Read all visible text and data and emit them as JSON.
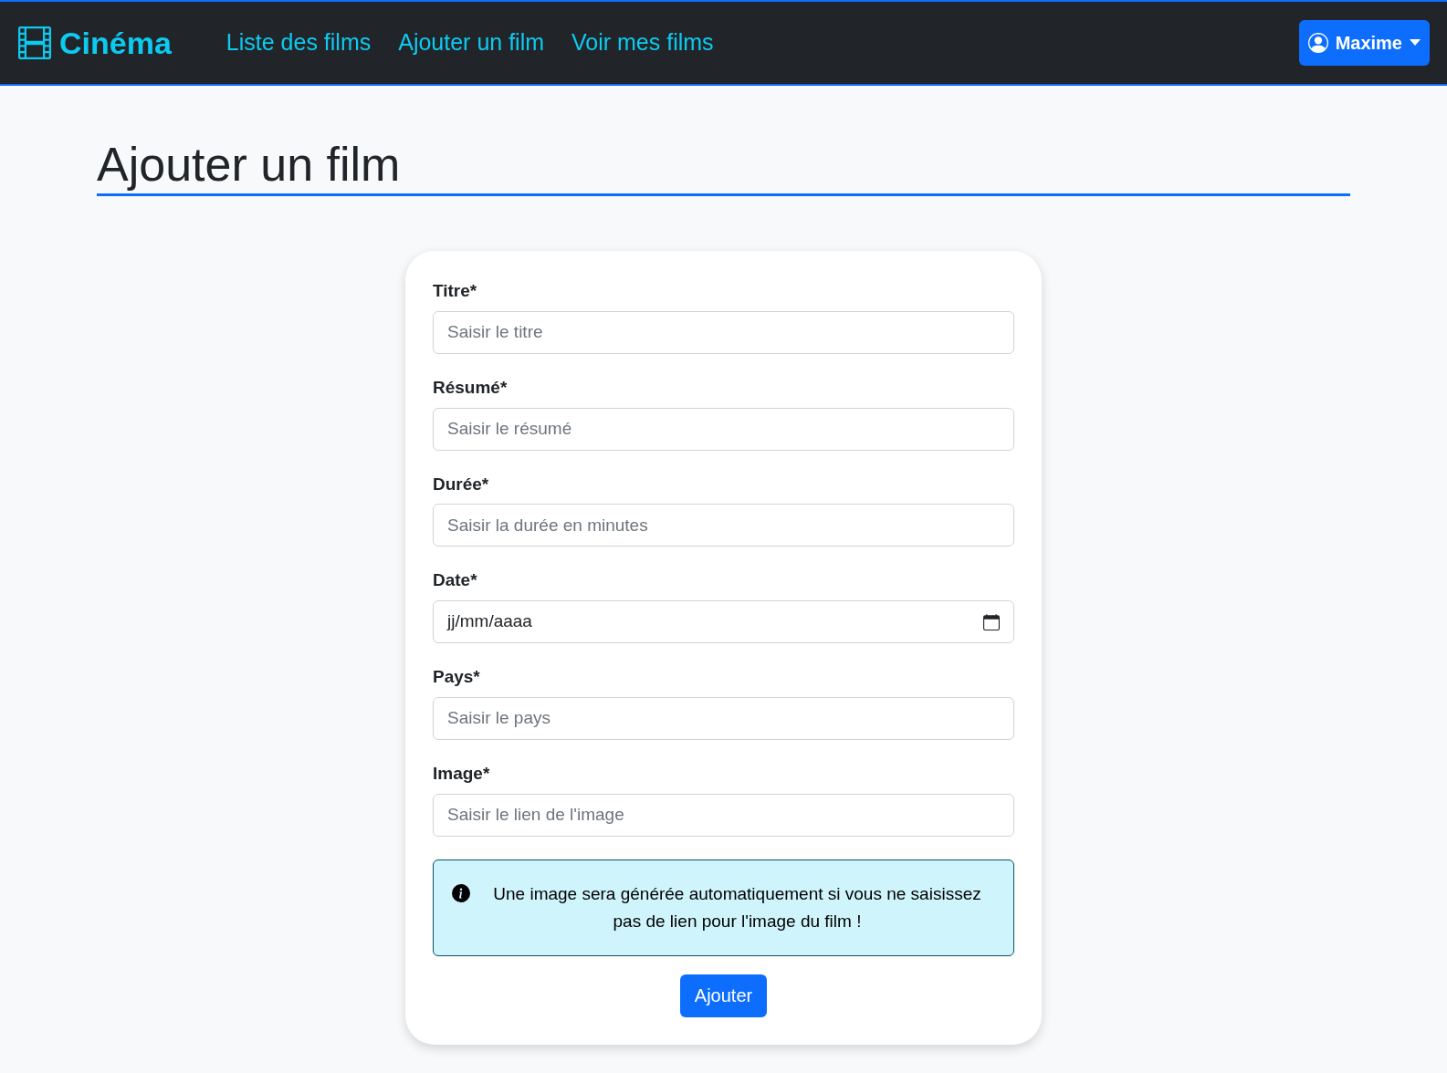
{
  "navbar": {
    "brand": "Cinéma",
    "links": [
      {
        "label": "Liste des films",
        "selected": false
      },
      {
        "label": "Ajouter un film",
        "selected": false
      },
      {
        "label": "Voir mes films",
        "selected": false
      }
    ],
    "user_menu": {
      "label": "Maxime"
    }
  },
  "page_title": "Ajouter un film",
  "form": {
    "fields": [
      {
        "kind": "text",
        "label": "Titre*",
        "placeholder": "Saisir le titre"
      },
      {
        "kind": "text",
        "label": "Résumé*",
        "placeholder": "Saisir le résumé"
      },
      {
        "kind": "text",
        "label": "Durée*",
        "placeholder": "Saisir la durée en minutes"
      },
      {
        "kind": "date",
        "label": "Date*",
        "value": "jj/mm/aaaa"
      },
      {
        "kind": "text",
        "label": "Pays*",
        "placeholder": "Saisir le pays"
      },
      {
        "kind": "text",
        "label": "Image*",
        "placeholder": "Saisir le lien de l'image"
      }
    ],
    "alert": "Une image sera générée automatiquement si vous ne saisissez pas de lien pour l'image du film !",
    "submit": "Ajouter"
  }
}
